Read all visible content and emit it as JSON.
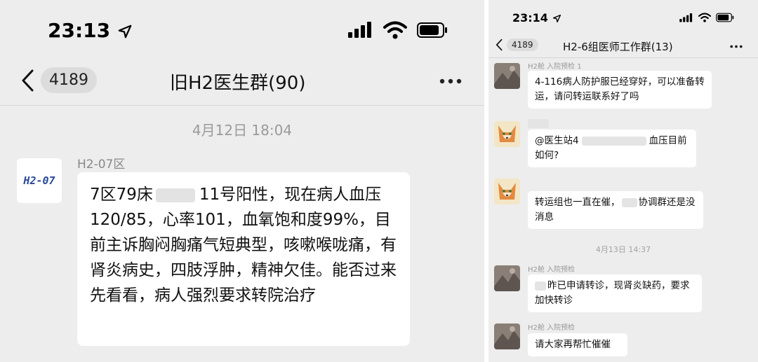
{
  "left": {
    "status": {
      "time": "23:13"
    },
    "nav": {
      "unread": "4189",
      "title": "旧H2医生群(90)"
    },
    "timestamp": "4月12日 18:04",
    "message": {
      "sender": "H2-07区",
      "avatar_text": "H2-07",
      "text_before": "7区79床",
      "text_after": "11号阳性，现在病人血压120/85，心率101，血氧饱和度99%，目前主诉胸闷胸痛气短典型，咳嗽喉咙痛，有肾炎病史，四肢浮肿，精神欠佳。能否过来先看看，病人强烈要求转院治疗"
    }
  },
  "right": {
    "status": {
      "time": "23:14"
    },
    "nav": {
      "unread": "4189",
      "title": "H2-6组医师工作群(13)"
    },
    "messages": [
      {
        "sender": "H2舱 入院预检 1",
        "text": "4-116病人防护服已经穿好，可以准备转运，请问转运联系好了吗"
      },
      {
        "sender": "",
        "text_before": "@医生站4",
        "text_after": "血压目前如何?"
      },
      {
        "sender": "",
        "text_before": "转运组也一直在催，",
        "text_after": "协调群还是没消息"
      },
      {
        "sender": "H2舱 入院预检",
        "text_before": "",
        "text_after": "昨已申请转诊，现肾炎缺药，要求加快转诊"
      },
      {
        "sender": "H2舱 入院预检",
        "text": "请大家再帮忙催催"
      }
    ],
    "timestamp": "4月13日 14:37"
  },
  "colors": {
    "background": "#ededed",
    "bubble": "#ffffff",
    "avatar_text": "#2c4a9a"
  },
  "icons": [
    "location-arrow-icon",
    "signal-icon",
    "wifi-icon",
    "battery-icon",
    "back-chevron-icon",
    "more-icon",
    "cartoon-fox-avatar-icon"
  ]
}
